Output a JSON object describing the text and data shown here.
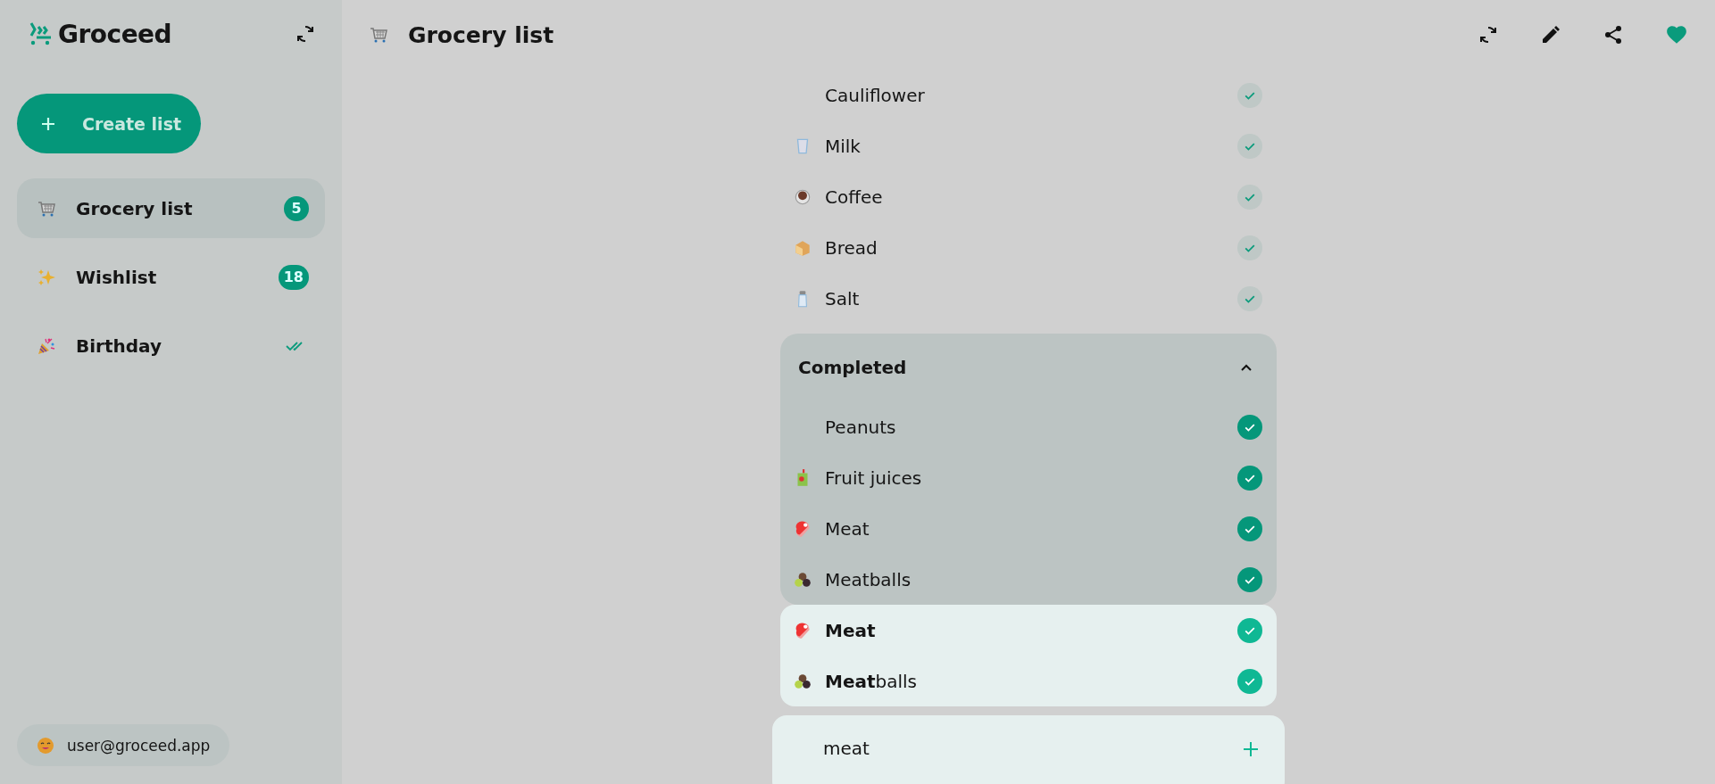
{
  "app": {
    "name": "Groceed"
  },
  "create_button": {
    "label": "Create list"
  },
  "lists": [
    {
      "name": "Grocery list",
      "selected": true,
      "badge": "5",
      "completed": false
    },
    {
      "name": "Wishlist",
      "selected": false,
      "badge": "18",
      "completed": false
    },
    {
      "name": "Birthday",
      "selected": false,
      "completed": true
    }
  ],
  "user": {
    "email": "user@groceed.app"
  },
  "header": {
    "title": "Grocery list",
    "favorite": true
  },
  "items": [
    {
      "name": "Cauliflower"
    },
    {
      "name": "Milk"
    },
    {
      "name": "Coffee"
    },
    {
      "name": "Bread"
    },
    {
      "name": "Salt"
    }
  ],
  "completed": {
    "title": "Completed",
    "expanded": true,
    "items": [
      {
        "name": "Peanuts",
        "checked": true
      },
      {
        "name": "Fruit juices",
        "checked": true
      },
      {
        "name": "Meat",
        "checked": true
      },
      {
        "name": "Meatballs",
        "checked": true
      }
    ]
  },
  "suggestions": [
    {
      "name": "**Meat**",
      "checked": true
    },
    {
      "name": "**Meat**balls",
      "checked": true
    }
  ],
  "new_item": {
    "value": "meat"
  }
}
